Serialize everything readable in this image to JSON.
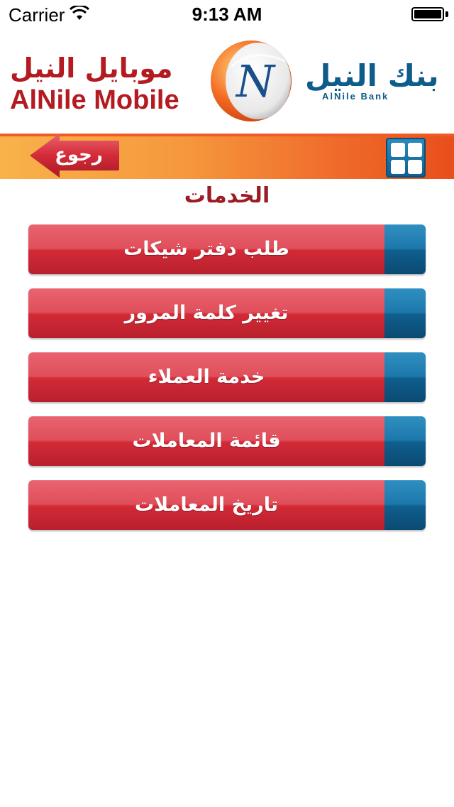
{
  "status_bar": {
    "carrier": "Carrier",
    "time": "9:13 AM"
  },
  "header": {
    "app_name_ar": "موبايل النيل",
    "app_name_en": "AlNile Mobile",
    "bank_name_ar": "بنك النيل",
    "bank_name_en": "AlNile Bank",
    "logo_letter": "N"
  },
  "nav": {
    "back_label": "رجوع",
    "menu_icon": "grid-icon"
  },
  "section_title": "الخدمات",
  "menu_items": [
    {
      "label": "طلب دفتر شيكات"
    },
    {
      "label": "تغيير كلمة المرور"
    },
    {
      "label": "خدمة العملاء"
    },
    {
      "label": "قائمة المعاملات"
    },
    {
      "label": "تاريخ المعاملات"
    }
  ],
  "colors": {
    "brand_red": "#b31b21",
    "brand_blue": "#0e5c8a",
    "nav_orange": "#ef6a2a",
    "button_red": "#d32a37",
    "button_blue": "#0f5f8f"
  }
}
